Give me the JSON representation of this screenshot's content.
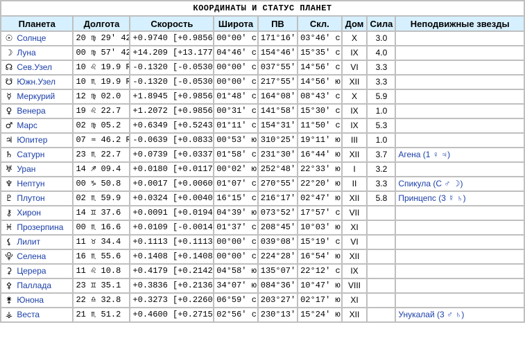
{
  "title": "КООРДИНАТЫ И СТАТУС ПЛАНЕТ",
  "headers": {
    "planet": "Планета",
    "longitude": "Долгота",
    "speed": "Скорость",
    "latitude": "Широта",
    "ra": "ПВ",
    "decl": "Скл.",
    "house": "Дом",
    "power": "Сила",
    "stars": "Неподвижные звезды"
  },
  "rows": [
    {
      "glyph": "☉",
      "name": "Солнце",
      "lon": "20 ♍ 29' 42\"",
      "speed": "+0.9740 [+0.9856]",
      "lat": "00°00' с",
      "ra": "171°16'",
      "decl": "03°46' с",
      "house": "X",
      "power": "3.0",
      "stars": ""
    },
    {
      "glyph": "☽",
      "name": "Луна",
      "lon": "00 ♍ 57' 42\"",
      "speed": "+14.209 [+13.177]",
      "lat": "04°46' с",
      "ra": "154°46'",
      "decl": "15°35' с",
      "house": "IX",
      "power": "4.0",
      "stars": ""
    },
    {
      "glyph": "☊",
      "name": "Сев.Узел",
      "lon": "10 ♌ 19.9 R",
      "speed": "-0.1320 [-0.0530]",
      "lat": "00°00' с",
      "ra": "037°55'",
      "decl": "14°56' с",
      "house": "VI",
      "power": "3.3",
      "stars": ""
    },
    {
      "glyph": "☋",
      "name": "Южн.Узел",
      "lon": "10 ♏ 19.9 R",
      "speed": "-0.1320 [-0.0530]",
      "lat": "00°00' с",
      "ra": "217°55'",
      "decl": "14°56' ю",
      "house": "XII",
      "power": "3.3",
      "stars": ""
    },
    {
      "glyph": "☿",
      "name": "Меркурий",
      "lon": "12 ♍ 02.0",
      "speed": "+1.8945 [+0.9856]",
      "lat": "01°48' с",
      "ra": "164°08'",
      "decl": "08°43' с",
      "house": "X",
      "power": "5.9",
      "stars": ""
    },
    {
      "glyph": "♀",
      "name": "Венера",
      "lon": "19 ♌ 22.7",
      "speed": "+1.2072 [+0.9856]",
      "lat": "00°31' с",
      "ra": "141°58'",
      "decl": "15°30' с",
      "house": "IX",
      "power": "1.0",
      "stars": ""
    },
    {
      "glyph": "♂",
      "name": "Марс",
      "lon": "02 ♍ 05.2",
      "speed": "+0.6349 [+0.5243]",
      "lat": "01°11' с",
      "ra": "154°31'",
      "decl": "11°50' с",
      "house": "IX",
      "power": "5.3",
      "stars": ""
    },
    {
      "glyph": "♃",
      "name": "Юпитер",
      "lon": "07 ♒ 46.2 R",
      "speed": "-0.0639 [+0.0833]",
      "lat": "00°53' ю",
      "ra": "310°25'",
      "decl": "19°11' ю",
      "house": "III",
      "power": "1.0",
      "stars": ""
    },
    {
      "glyph": "♄",
      "name": "Сатурн",
      "lon": "23 ♏ 22.7",
      "speed": "+0.0739 [+0.0337]",
      "lat": "01°58' с",
      "ra": "231°30'",
      "decl": "16°44' ю",
      "house": "XII",
      "power": "3.7",
      "stars": "Агена (1 ♀ ♃)"
    },
    {
      "glyph": "♅",
      "name": "Уран",
      "lon": "14 ♐ 09.4",
      "speed": "+0.0180 [+0.0117]",
      "lat": "00°02' ю",
      "ra": "252°48'",
      "decl": "22°33' ю",
      "house": "I",
      "power": "3.2",
      "stars": ""
    },
    {
      "glyph": "♆",
      "name": "Нептун",
      "lon": "00 ♑ 50.8",
      "speed": "+0.0017 [+0.0060]",
      "lat": "01°07' с",
      "ra": "270°55'",
      "decl": "22°20' ю",
      "house": "II",
      "power": "3.3",
      "stars": "Спикула (С ♂ ☽)"
    },
    {
      "glyph": "♇",
      "name": "Плутон",
      "lon": "02 ♏ 59.9",
      "speed": "+0.0324 [+0.0040]",
      "lat": "16°15' с",
      "ra": "216°17'",
      "decl": "02°47' ю",
      "house": "XII",
      "power": "5.8",
      "stars": "Принцепс (3 ☿ ♄)"
    },
    {
      "glyph": "⚷",
      "name": "Хирон",
      "lon": "14 ♊ 37.6",
      "speed": "+0.0091 [+0.0194]",
      "lat": "04°39' ю",
      "ra": "073°52'",
      "decl": "17°57' с",
      "house": "VII",
      "power": "",
      "stars": ""
    },
    {
      "glyph": "♓",
      "name": "Прозерпина",
      "lon": "00 ♏ 16.6",
      "speed": "+0.0109 [-0.0014]",
      "lat": "01°37' с",
      "ra": "208°45'",
      "decl": "10°03' ю",
      "house": "XI",
      "power": "",
      "stars": ""
    },
    {
      "glyph": "⚸",
      "name": "Лилит",
      "lon": "11 ♉ 34.4",
      "speed": "+0.1113 [+0.1113]",
      "lat": "00°00' с",
      "ra": "039°08'",
      "decl": "15°19' с",
      "house": "VI",
      "power": "",
      "stars": ""
    },
    {
      "glyph": "⯓",
      "name": "Селена",
      "lon": "16 ♏ 55.6",
      "speed": "+0.1408 [+0.1408]",
      "lat": "00°00' с",
      "ra": "224°28'",
      "decl": "16°54' ю",
      "house": "XII",
      "power": "",
      "stars": ""
    },
    {
      "glyph": "⚳",
      "name": "Церера",
      "lon": "11 ♌ 10.8",
      "speed": "+0.4179 [+0.2142]",
      "lat": "04°58' ю",
      "ra": "135°07'",
      "decl": "22°12' с",
      "house": "IX",
      "power": "",
      "stars": ""
    },
    {
      "glyph": "⚴",
      "name": "Паллада",
      "lon": "23 ♊ 35.1",
      "speed": "+0.3836 [+0.2136]",
      "lat": "34°07' ю",
      "ra": "084°36'",
      "decl": "10°47' ю",
      "house": "VIII",
      "power": "",
      "stars": ""
    },
    {
      "glyph": "⚵",
      "name": "Юнона",
      "lon": "22 ♎ 32.8",
      "speed": "+0.3273 [+0.2260]",
      "lat": "06°59' с",
      "ra": "203°27'",
      "decl": "02°17' ю",
      "house": "XI",
      "power": "",
      "stars": ""
    },
    {
      "glyph": "⚶",
      "name": "Веста",
      "lon": "21 ♏ 51.2",
      "speed": "+0.4600 [+0.2715]",
      "lat": "02°56' с",
      "ra": "230°13'",
      "decl": "15°24' ю",
      "house": "XII",
      "power": "",
      "stars": "Унукалай (3 ♂ ♄)"
    }
  ]
}
